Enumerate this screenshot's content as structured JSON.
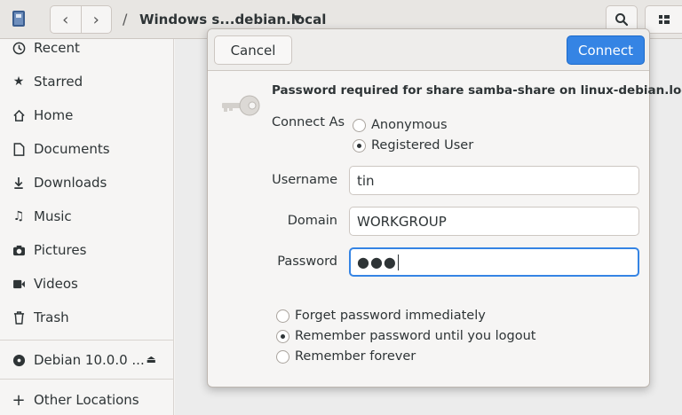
{
  "headerbar": {
    "path_separator": "/",
    "location_label": "Windows s...debian.local",
    "icons": {
      "app": "files-app-icon",
      "back": "go-back-icon",
      "forward": "go-forward-icon",
      "menu": "dropdown-arrow-icon",
      "search": "search-icon",
      "view": "view-toggle-icon"
    }
  },
  "sidebar": {
    "items": [
      {
        "label": "Recent",
        "icon": "clock-icon"
      },
      {
        "label": "Starred",
        "icon": "star-icon"
      },
      {
        "label": "Home",
        "icon": "home-icon"
      },
      {
        "label": "Documents",
        "icon": "document-icon"
      },
      {
        "label": "Downloads",
        "icon": "download-icon"
      },
      {
        "label": "Music",
        "icon": "music-icon"
      },
      {
        "label": "Pictures",
        "icon": "camera-icon"
      },
      {
        "label": "Videos",
        "icon": "video-icon"
      },
      {
        "label": "Trash",
        "icon": "trash-icon"
      },
      {
        "label": "Debian 10.0.0 ...",
        "icon": "disc-icon"
      },
      {
        "label": "Other Locations",
        "icon": "plus-icon"
      }
    ]
  },
  "dialog": {
    "cancel_label": "Cancel",
    "connect_label": "Connect",
    "title": "Password required for share samba-share on linux-debian.local",
    "connect_as_label": "Connect As",
    "connect_as_options": [
      {
        "label": "Anonymous",
        "selected": false
      },
      {
        "label": "Registered User",
        "selected": true
      }
    ],
    "username_label": "Username",
    "username_value": "tin",
    "domain_label": "Domain",
    "domain_value": "WORKGROUP",
    "password_label": "Password",
    "password_mask": "●●●",
    "remember_options": [
      {
        "label": "Forget password immediately",
        "selected": false
      },
      {
        "label": "Remember password until you logout",
        "selected": true
      },
      {
        "label": "Remember forever",
        "selected": false
      }
    ]
  },
  "colors": {
    "accent": "#3584e4",
    "headerbar_bg": "#e8e6e3",
    "sidebar_bg": "#f6f5f4"
  }
}
